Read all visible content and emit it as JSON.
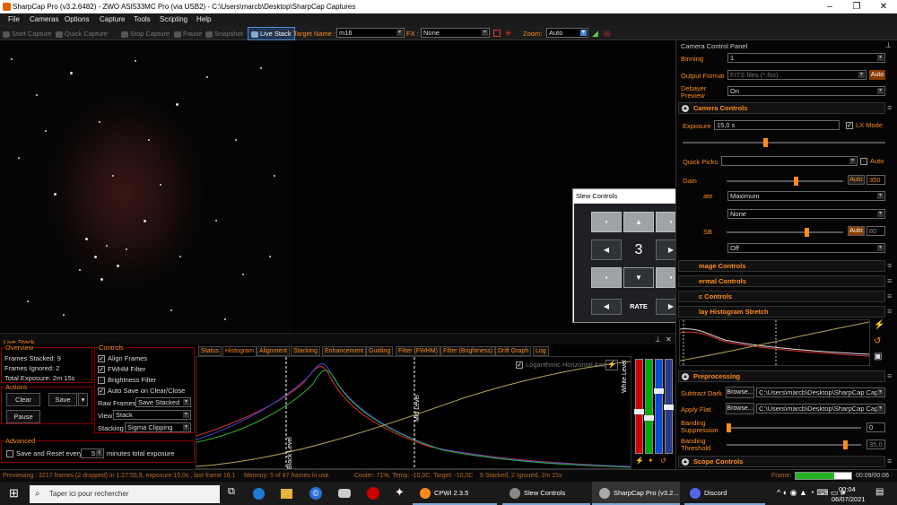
{
  "window": {
    "title": "SharpCap Pro (v3.2.6482) - ZWO ASI533MC Pro (via USB2) - C:\\Users\\marcb\\Desktop\\SharpCap Captures"
  },
  "menu": [
    "File",
    "Cameras",
    "Options",
    "Capture",
    "Tools",
    "Scripting",
    "Help"
  ],
  "toolbar": {
    "start_capture": "Start Capture",
    "quick_capture": "Quick Capture",
    "stop_capture": "Stop Capture",
    "pause": "Pause",
    "snapshot": "Snapshot",
    "live_stack": "Live Stack",
    "target_label": "Target Name :",
    "target_value": "m16",
    "fx_label": "FX :",
    "fx_value": "None",
    "zoom_label": "Zoom:",
    "zoom_value": "Auto"
  },
  "livestack": {
    "title": "Live Stack",
    "overview_label": "Overview",
    "frames_stacked": "Frames Stacked: 9",
    "frames_ignored": "Frames Ignored: 2",
    "total_exposure": "Total Exposure: 2m 15s",
    "actions_label": "Actions",
    "clear": "Clear",
    "save": "Save",
    "pause": "Pause",
    "controls_label": "Controls",
    "align_frames": "Align Frames",
    "fwhm_filter": "FWHM Filter",
    "brightness_filter": "Brightness Filter",
    "auto_save": "Auto Save on Clear/Close",
    "raw_frames_label": "Raw Frames",
    "raw_frames_value": "Save Stacked",
    "view_label": "View",
    "view_value": "Stack",
    "stacking_label": "Stacking",
    "stacking_value": "Sigma Clipping",
    "advanced_label": "Advanced",
    "save_reset": "Save and Reset every",
    "save_reset_value": "5",
    "minutes_total": "minutes total exposure"
  },
  "tabs": [
    "Status",
    "Histogram",
    "Alignment",
    "Stacking",
    "Enhancement",
    "Guiding",
    "Filter (FWHM)",
    "Filter (Brightness)",
    "Drift Graph",
    "Log"
  ],
  "histogram": {
    "log_axis": "Logarithmic Horizontal Axis",
    "black_level": "Black Level",
    "mid_level": "Mid Level",
    "white_level": "White Level"
  },
  "status": {
    "previewing": "Previewing : 3217 frames (2 dropped) in 1:27:55,9, exposure 15,0s , last frame 16,1",
    "memory": "Memory: 5 of 87 frames in use.",
    "cooler": "Cooler: 71%, Temp: -10,0C, Target: -10,0C",
    "stacked": "9 Stacked, 2 Ignored, 2m 15s",
    "frame_label": "Frame:",
    "frame_progress": 0.7,
    "frame_time": "00:09/00:06"
  },
  "camera_panel": {
    "title": "Camera Control Panel",
    "binning_label": "Binning",
    "binning_value": "1",
    "output_label": "Output Format",
    "output_value": "FITS files (*.fits)",
    "auto": "Auto",
    "debayer_label": "Debayer Preview",
    "debayer_value": "On",
    "camera_controls": "Camera Controls",
    "exposure_label": "Exposure",
    "exposure_value": "15,0 s",
    "lx_mode": "LX Mode",
    "quick_picks_label": "Quick Picks",
    "gain_label": "Gain",
    "gain_value": "350",
    "row_rate_fragment": "ate",
    "rate_value": "Maximum",
    "none_value": "None",
    "usb_fragment": "SB",
    "usb_value": "80",
    "off_value": "Off",
    "image_controls": "mage Controls",
    "thermal_controls": "ermal Controls",
    "misc_controls": "c Controls",
    "display_hist": "lay Histogram Stretch",
    "preprocessing": "Preprocessing",
    "subtract_dark": "Subtract Dark",
    "browse": "Browse...",
    "dark_path": "C:\\Users\\marcb\\Desktop\\SharpCap Cap...",
    "apply_flat": "Apply Flat",
    "flat_path": "C:\\Users\\marcb\\Desktop\\SharpCap Cap...",
    "banding_supp": "Banding Suppression",
    "banding_supp_value": "0",
    "banding_thresh": "Banding Threshold",
    "banding_thresh_value": "35,0",
    "scope_controls": "Scope Controls"
  },
  "slew": {
    "title": "Slew Controls",
    "speed": "3",
    "rate": "RATE"
  },
  "taskbar": {
    "search": "Taper ici pour rechercher",
    "apps": [
      "CPWI 2.3.5",
      "Slew Controls",
      "SharpCap Pro (v3.2...",
      "Discord"
    ],
    "time": "00:04",
    "date": "06/07/2021"
  },
  "colors": {
    "accent": "#ff8c1a",
    "border_red": "#8b0000",
    "frame_green": "#22b422"
  }
}
